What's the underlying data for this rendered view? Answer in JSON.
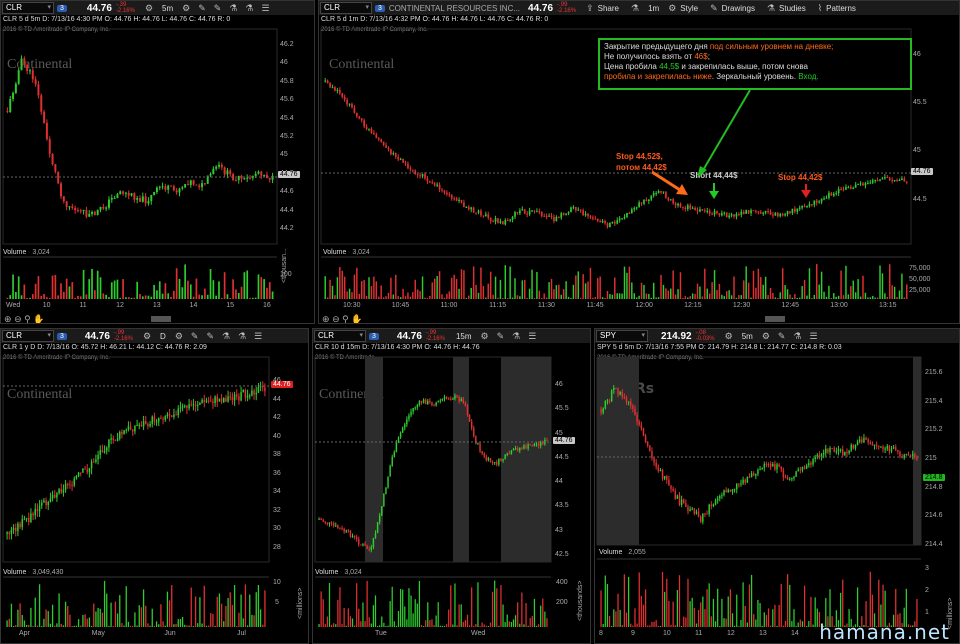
{
  "panes": {
    "p1": {
      "symbol": "CLR",
      "badge": "3",
      "price": "44.76",
      "chg1": "-.39",
      "chg2": "-2.16%",
      "timeframe": "5m",
      "sub": "CLR 5 d 5m   D: 7/13/16 4:30 PM   O: 44.76   H: 44.76   L: 44.76   C: 44.76   R: 0",
      "copy": "2016 © TD Ameritrade IP Company, Inc.",
      "wm": "Continental",
      "volume": "Volume",
      "vol_val": "3,024",
      "ticks": [
        "46.2",
        "46",
        "45.8",
        "45.6",
        "45.4",
        "45.2",
        "45",
        "44.8",
        "44.6",
        "44.4",
        "44.2"
      ],
      "last": "44.76",
      "vol_ticks": [
        "100",
        "<thousan..."
      ],
      "x_labels": [
        "Wed",
        "10",
        "11",
        "12",
        "13",
        "14",
        "15",
        "16"
      ]
    },
    "p2": {
      "symbol": "CLR",
      "badge": "3",
      "company": "CONTINENTAL RESOURCES INC...",
      "price": "44.76",
      "chg1": "-.99",
      "chg2": "-2.16%",
      "share": "Share",
      "timeframe": "1m",
      "style": "Style",
      "drawings": "Drawings",
      "studies": "Studies",
      "patterns": "Patterns",
      "sub": "CLR 5 d 1m   D: 7/13/16 4:32 PM   O: 44.76   H: 44.76   L: 44.76   C: 44.76   R: 0",
      "copy": "2016 © TD Ameritrade IP Company, Inc.",
      "wm": "Continental",
      "volume": "Volume",
      "vol_val": "3,024",
      "ticks": [
        "46",
        "45.5",
        "45",
        "44.76",
        "44.5"
      ],
      "vol_ticks": [
        "75,000",
        "50,000",
        "25,000"
      ],
      "x_labels": [
        "10:30",
        "10:45",
        "11:00",
        "11:15",
        "11:30",
        "11:45",
        "12:00",
        "12:15",
        "12:30",
        "12:45",
        "13:00",
        "13:15"
      ],
      "note": {
        "l1a": "Закрытие предыдущего дня ",
        "l1b": "под сильным уровнем на дневке;",
        "l2a": "Не получилось взять от ",
        "l2b": "46$",
        "l2c": ";",
        "l3a": "Цена пробила ",
        "l3b": "44,5$",
        "l3c": " и закрепилась выше, потом снова",
        "l4a": "пробила и закрепилась ниже",
        "l4b": ". Зеркальный уровень. ",
        "l4c": "Вход."
      },
      "ann_stop1": "Stop 44,52$,",
      "ann_stop2": "потом 44,42$",
      "ann_short": "Short 44,44$",
      "ann_stop3": "Stop 44,42$"
    },
    "p3": {
      "symbol": "CLR",
      "badge": "3",
      "price": "44.76",
      "chg1": "-.99",
      "chg2": "-2.16%",
      "timeframe": "D",
      "sub": "CLR 1 y D   D: 7/13/16   O: 45.72   H: 46.21   L: 44.12   C: 44.76   R: 2.09",
      "copy": "2016 © TD Ameritrade IP Company, Inc.",
      "wm": "Continental",
      "volume": "Volume",
      "vol_val": "3,049,430",
      "ticks": [
        "46",
        "44",
        "42",
        "40",
        "38",
        "36",
        "34",
        "32",
        "30",
        "28"
      ],
      "last": "44.76",
      "vol_ticks": [
        "10",
        "5",
        "<millions>"
      ],
      "x_labels": [
        "Apr",
        "May",
        "Jun",
        "Jul"
      ]
    },
    "p4": {
      "symbol": "CLR",
      "badge": "3",
      "price": "44.76",
      "chg1": "-.99",
      "chg2": "-2.16%",
      "timeframe": "15m",
      "sub": "CLR 10 d 15m   D: 7/13/16 4:30 PM   O: 44.76   H: 44.76",
      "copy": "2016 © TD Ameritrade",
      "wm": "Continental",
      "volume": "Volume",
      "vol_val": "3,024",
      "ticks": [
        "46",
        "45.5",
        "45",
        "44.5",
        "44",
        "43.5",
        "43",
        "42.5"
      ],
      "last": "44.76",
      "vol_ticks": [
        "400",
        "200",
        "<thousands>"
      ],
      "x_labels": [
        "Tue",
        "Wed"
      ]
    },
    "p5": {
      "symbol": "SPY",
      "price": "214.92",
      "chg1": "-.08",
      "chg2": "-0.03%",
      "timeframe": "5m",
      "sub": "SPY 5 d 5m   D: 7/13/16 7:55 PM   O: 214.79   H: 214.8   L: 214.77   C: 214.8   R: 0.03",
      "copy": "2016 © TD Ameritrade IP Company, Inc.",
      "wm": "SPDRs",
      "volume": "Volume",
      "vol_val": "2,055",
      "ticks": [
        "215.6",
        "215.4",
        "215.2",
        "215",
        "214.8",
        "214.6",
        "214.4"
      ],
      "last": "214.8",
      "vol_ticks": [
        "3",
        "2",
        "1",
        "<millions>"
      ],
      "x_labels": [
        "8",
        "9",
        "10",
        "11",
        "12",
        "13",
        "14"
      ]
    }
  },
  "watermark": "hamana.net",
  "colors": {
    "up": "#2ecc2e",
    "down": "#e03030",
    "last": "#c0c0c0",
    "note": "#22bb22"
  }
}
